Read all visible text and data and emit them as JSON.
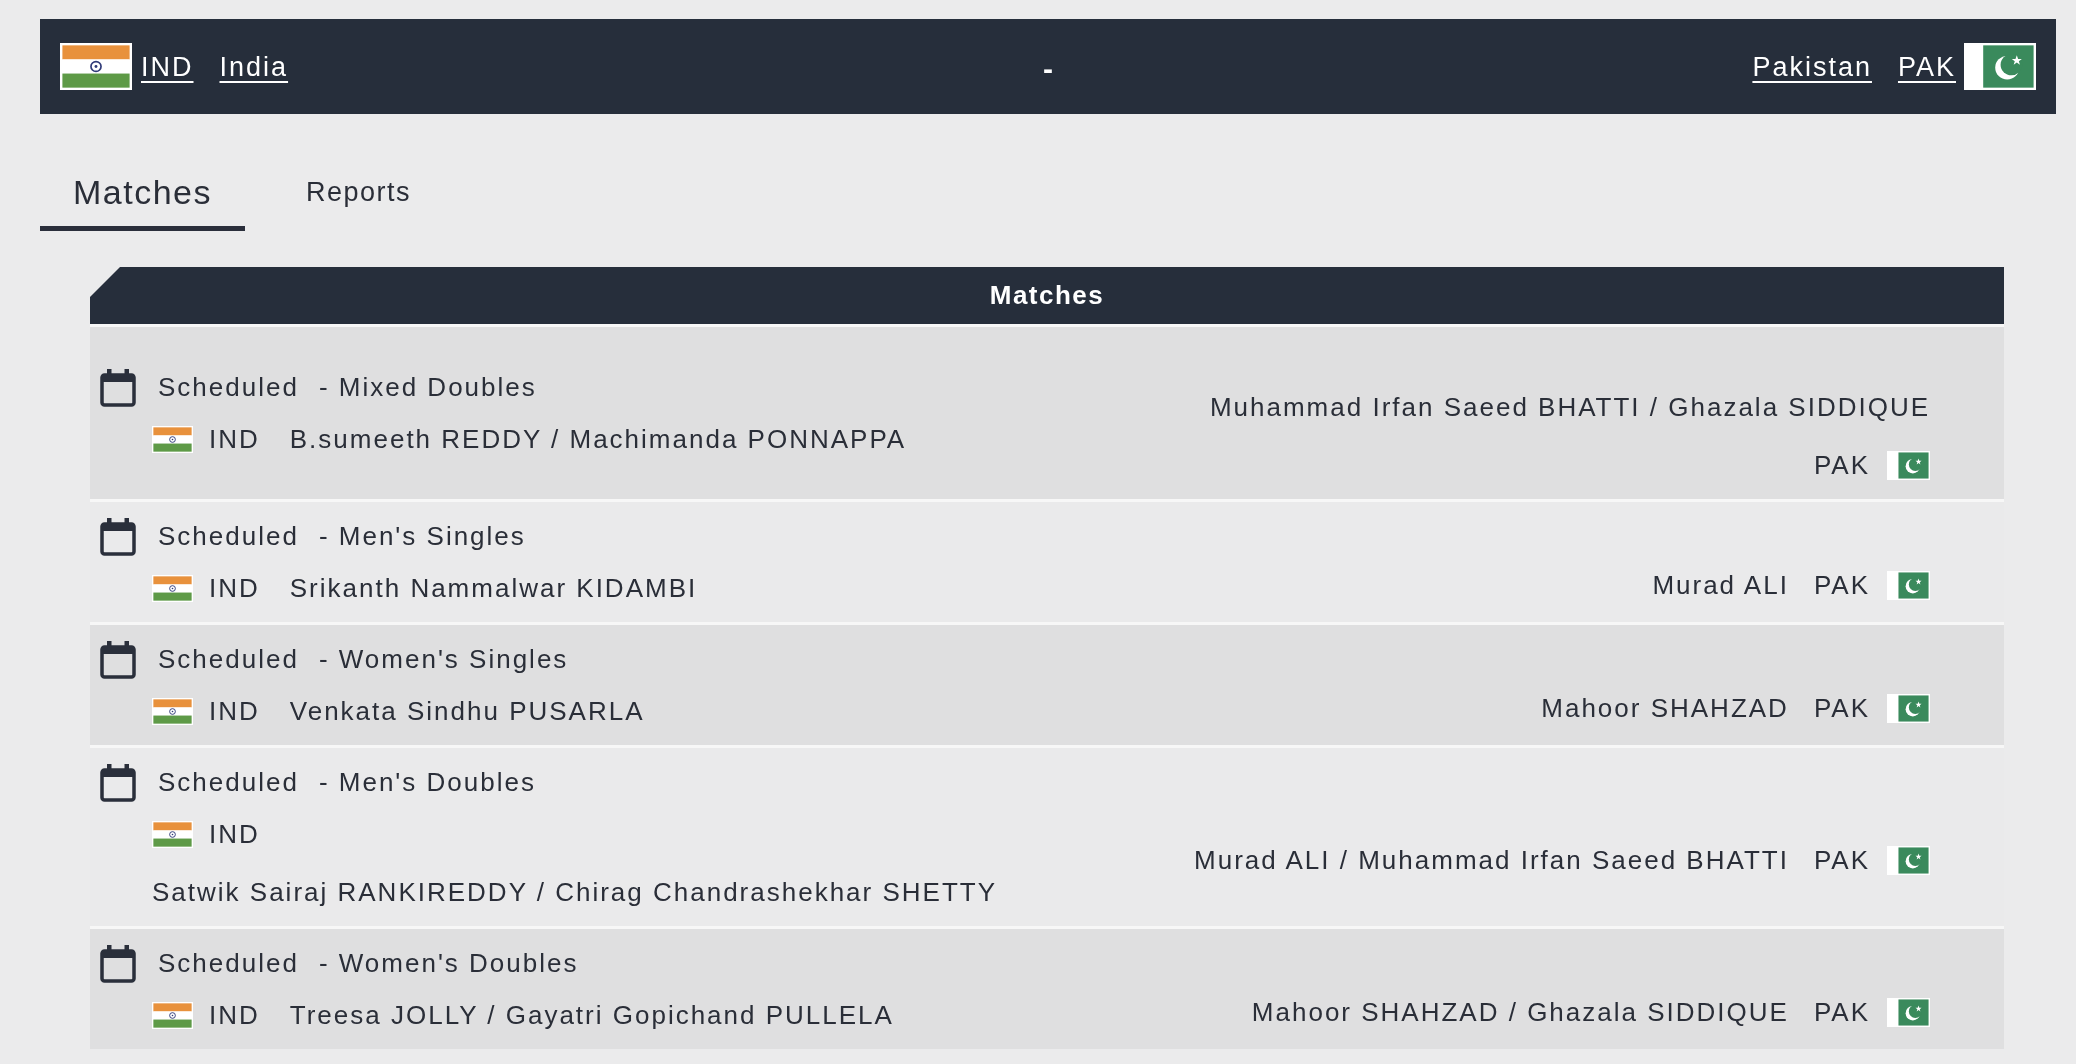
{
  "header": {
    "home": {
      "code": "IND",
      "name": "India"
    },
    "separator": "-",
    "away": {
      "name": "Pakistan",
      "code": "PAK"
    }
  },
  "tabs": [
    {
      "label": "Matches",
      "selected": true
    },
    {
      "label": "Reports",
      "selected": false
    }
  ],
  "panel": {
    "title": "Matches",
    "matches": [
      {
        "status": "Scheduled",
        "event": "- Mixed Doubles",
        "home": {
          "code": "IND",
          "players": "B.sumeeth REDDY / Machimanda PONNAPPA"
        },
        "away": {
          "players": "Muhammad Irfan Saeed BHATTI / Ghazala SIDDIQUE",
          "code": "PAK"
        }
      },
      {
        "status": "Scheduled",
        "event": "- Men's Singles",
        "home": {
          "code": "IND",
          "players": "Srikanth Nammalwar KIDAMBI"
        },
        "away": {
          "players": "Murad ALI",
          "code": "PAK"
        }
      },
      {
        "status": "Scheduled",
        "event": "- Women's Singles",
        "home": {
          "code": "IND",
          "players": "Venkata Sindhu PUSARLA"
        },
        "away": {
          "players": "Mahoor SHAHZAD",
          "code": "PAK"
        }
      },
      {
        "status": "Scheduled",
        "event": "- Men's Doubles",
        "home": {
          "code": "IND",
          "players": "Satwik Sairaj RANKIREDDY / Chirag Chandrashekhar SHETTY"
        },
        "away": {
          "players": "Murad ALI / Muhammad Irfan Saeed BHATTI",
          "code": "PAK"
        }
      },
      {
        "status": "Scheduled",
        "event": "- Women's Doubles",
        "home": {
          "code": "IND",
          "players": "Treesa JOLLY / Gayatri Gopichand PULLELA"
        },
        "away": {
          "players": "Mahoor SHAHZAD / Ghazala SIDDIQUE",
          "code": "PAK"
        }
      }
    ]
  }
}
